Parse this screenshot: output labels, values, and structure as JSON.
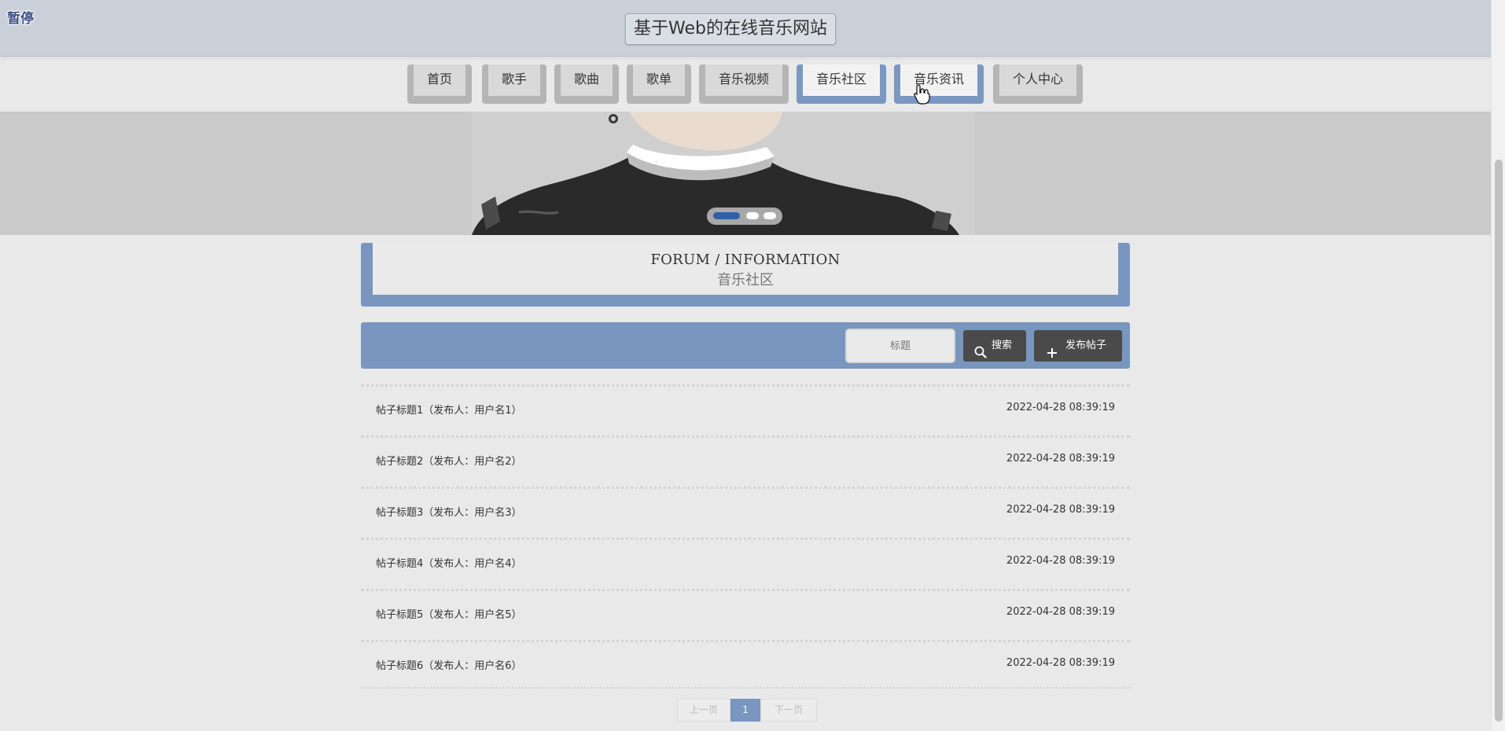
{
  "header": {
    "pause_label": "暂停",
    "site_title": "基于Web的在线音乐网站"
  },
  "nav": {
    "items": [
      {
        "label": "首页"
      },
      {
        "label": "歌手"
      },
      {
        "label": "歌曲"
      },
      {
        "label": "歌单"
      },
      {
        "label": "音乐视频"
      },
      {
        "label": "音乐社区"
      },
      {
        "label": "音乐资讯"
      },
      {
        "label": "个人中心"
      }
    ]
  },
  "banner": {
    "slide_count": 3,
    "active_slide": 1
  },
  "section": {
    "title_en": "FORUM / INFORMATION",
    "title_cn": "音乐社区"
  },
  "search": {
    "placeholder": "标题",
    "search_button": "搜索",
    "post_button": "发布帖子",
    "search_icon": "search-icon",
    "post_icon": "plus-icon"
  },
  "posts": [
    {
      "title": "帖子标题1（发布人：用户名1）",
      "time": "2022-04-28 08:39:19"
    },
    {
      "title": "帖子标题2（发布人：用户名2）",
      "time": "2022-04-28 08:39:19"
    },
    {
      "title": "帖子标题3（发布人：用户名3）",
      "time": "2022-04-28 08:39:19"
    },
    {
      "title": "帖子标题4（发布人：用户名4）",
      "time": "2022-04-28 08:39:19"
    },
    {
      "title": "帖子标题5（发布人：用户名5）",
      "time": "2022-04-28 08:39:19"
    },
    {
      "title": "帖子标题6（发布人：用户名6）",
      "time": "2022-04-28 08:39:19"
    }
  ],
  "pagination": {
    "prev": "上一页",
    "current": "1",
    "next": "下一页"
  },
  "colors": {
    "accent": "#7896be",
    "header_bg": "#c9d0d9",
    "button_dark": "#4a4a4a",
    "dot_active": "#2e62a7"
  }
}
